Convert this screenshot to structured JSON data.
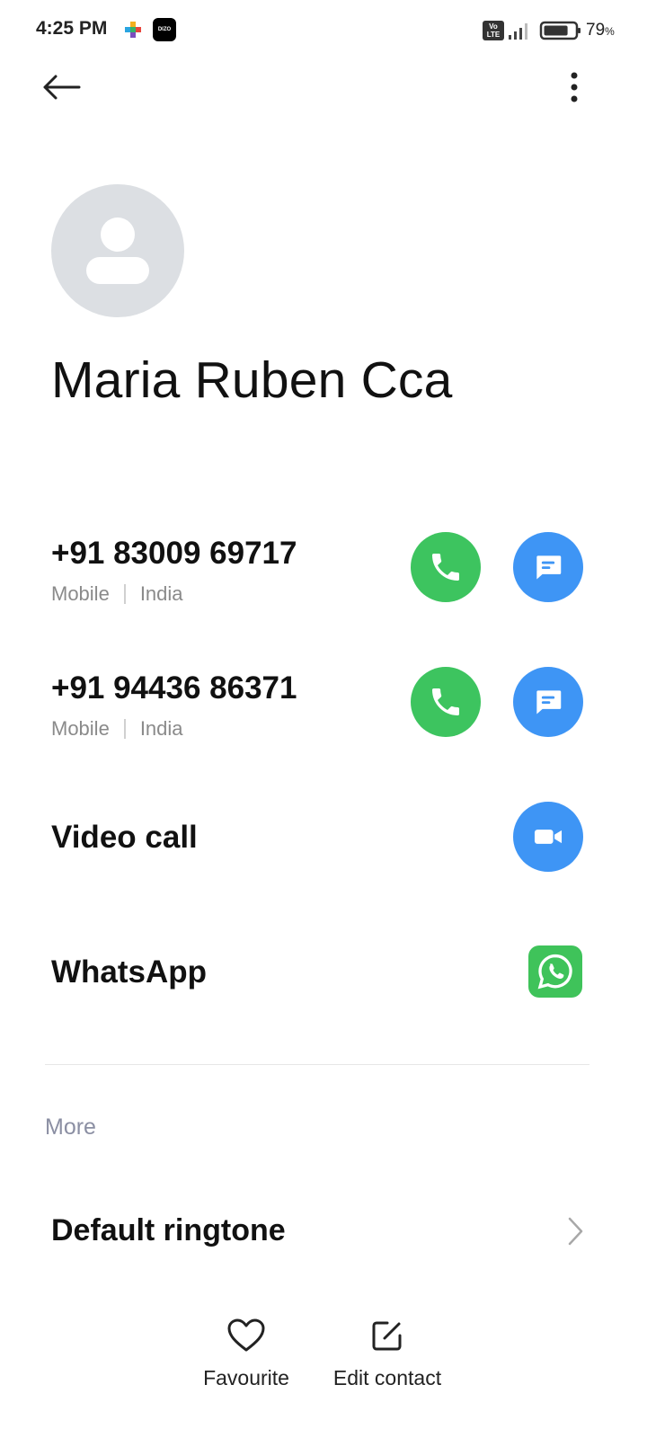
{
  "status_bar": {
    "time": "4:25 PM",
    "app_badge_2": "DIZO",
    "volte": "Vo LTE",
    "battery_percent": "79",
    "battery_unit": "%",
    "battery_level": 0.79
  },
  "toolbar": {
    "back_icon": "arrow-left-icon",
    "more_icon": "more-vertical-icon"
  },
  "contact": {
    "name": "Maria Ruben Cca",
    "avatar_icon": "person-placeholder-icon"
  },
  "phones": [
    {
      "number": "+91 83009 69717",
      "type": "Mobile",
      "region": "India"
    },
    {
      "number": "+91 94436 86371",
      "type": "Mobile",
      "region": "India"
    }
  ],
  "video_call": {
    "label": "Video call",
    "icon": "video-camera-icon"
  },
  "whatsapp": {
    "label": "WhatsApp",
    "icon": "whatsapp-icon"
  },
  "more_section": {
    "header": "More",
    "ringtone_label": "Default ringtone"
  },
  "bottom_bar": {
    "favourite_label": "Favourite",
    "edit_label": "Edit contact"
  },
  "colors": {
    "call_green": "#3dc45f",
    "message_blue": "#3e95f5",
    "whatsapp_green": "#3fc35a",
    "avatar_gray": "#dcdfe3"
  }
}
